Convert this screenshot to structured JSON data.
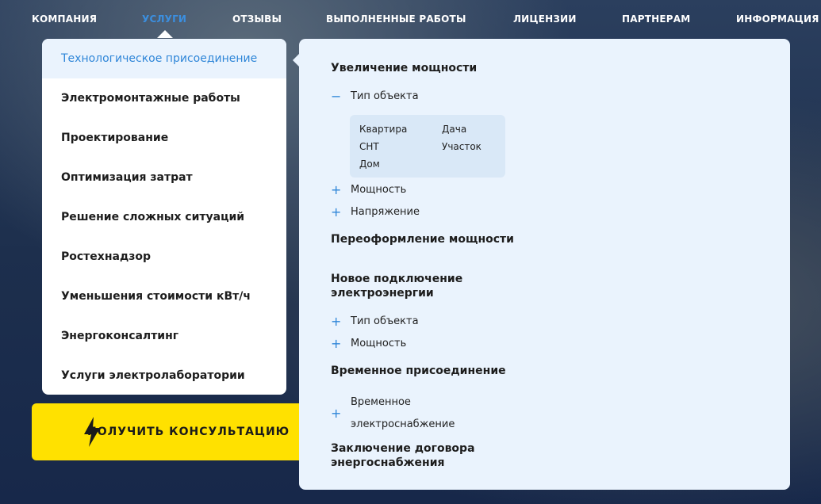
{
  "nav": [
    "КОМПАНИЯ",
    "УСЛУГИ",
    "ОТЗЫВЫ",
    "ВЫПОЛНЕННЫЕ РАБОТЫ",
    "ЛИЦЕНЗИИ",
    "ПАРТНЕРАМ",
    "ИНФОРМАЦИЯ"
  ],
  "menu": [
    "Технологическое присоединение",
    "Электромонтажные работы",
    "Проектирование",
    "Оптимизация затрат",
    "Решение сложных ситуаций",
    "Ростехнадзор",
    "Уменьшения стоимости кВт/ч",
    "Энергоконсалтинг",
    "Услуги электролаборатории"
  ],
  "submenu": {
    "h1": "Увеличение мощности",
    "t1": "Тип объекта",
    "opts": [
      "Квартира",
      "Дача",
      "СНТ",
      "Участок",
      "Дом"
    ],
    "t2": "Мощность",
    "t3": "Напряжение",
    "h2": "Переоформление мощности",
    "h3": "Новое подключение электроэнергии",
    "t4": "Тип объекта",
    "t5": "Мощность",
    "h4": "Временное присоединение",
    "t6a": "Временное",
    "t6b": "электроснабжение",
    "h5": "Заключение договора энергоснабжения",
    "minus": "−",
    "plus": "+"
  },
  "cta": "ПОЛУЧИТЬ КОНСУЛЬТАЦИЮ",
  "colors": {
    "accent": "#2f86d8",
    "cta": "#ffe100"
  }
}
